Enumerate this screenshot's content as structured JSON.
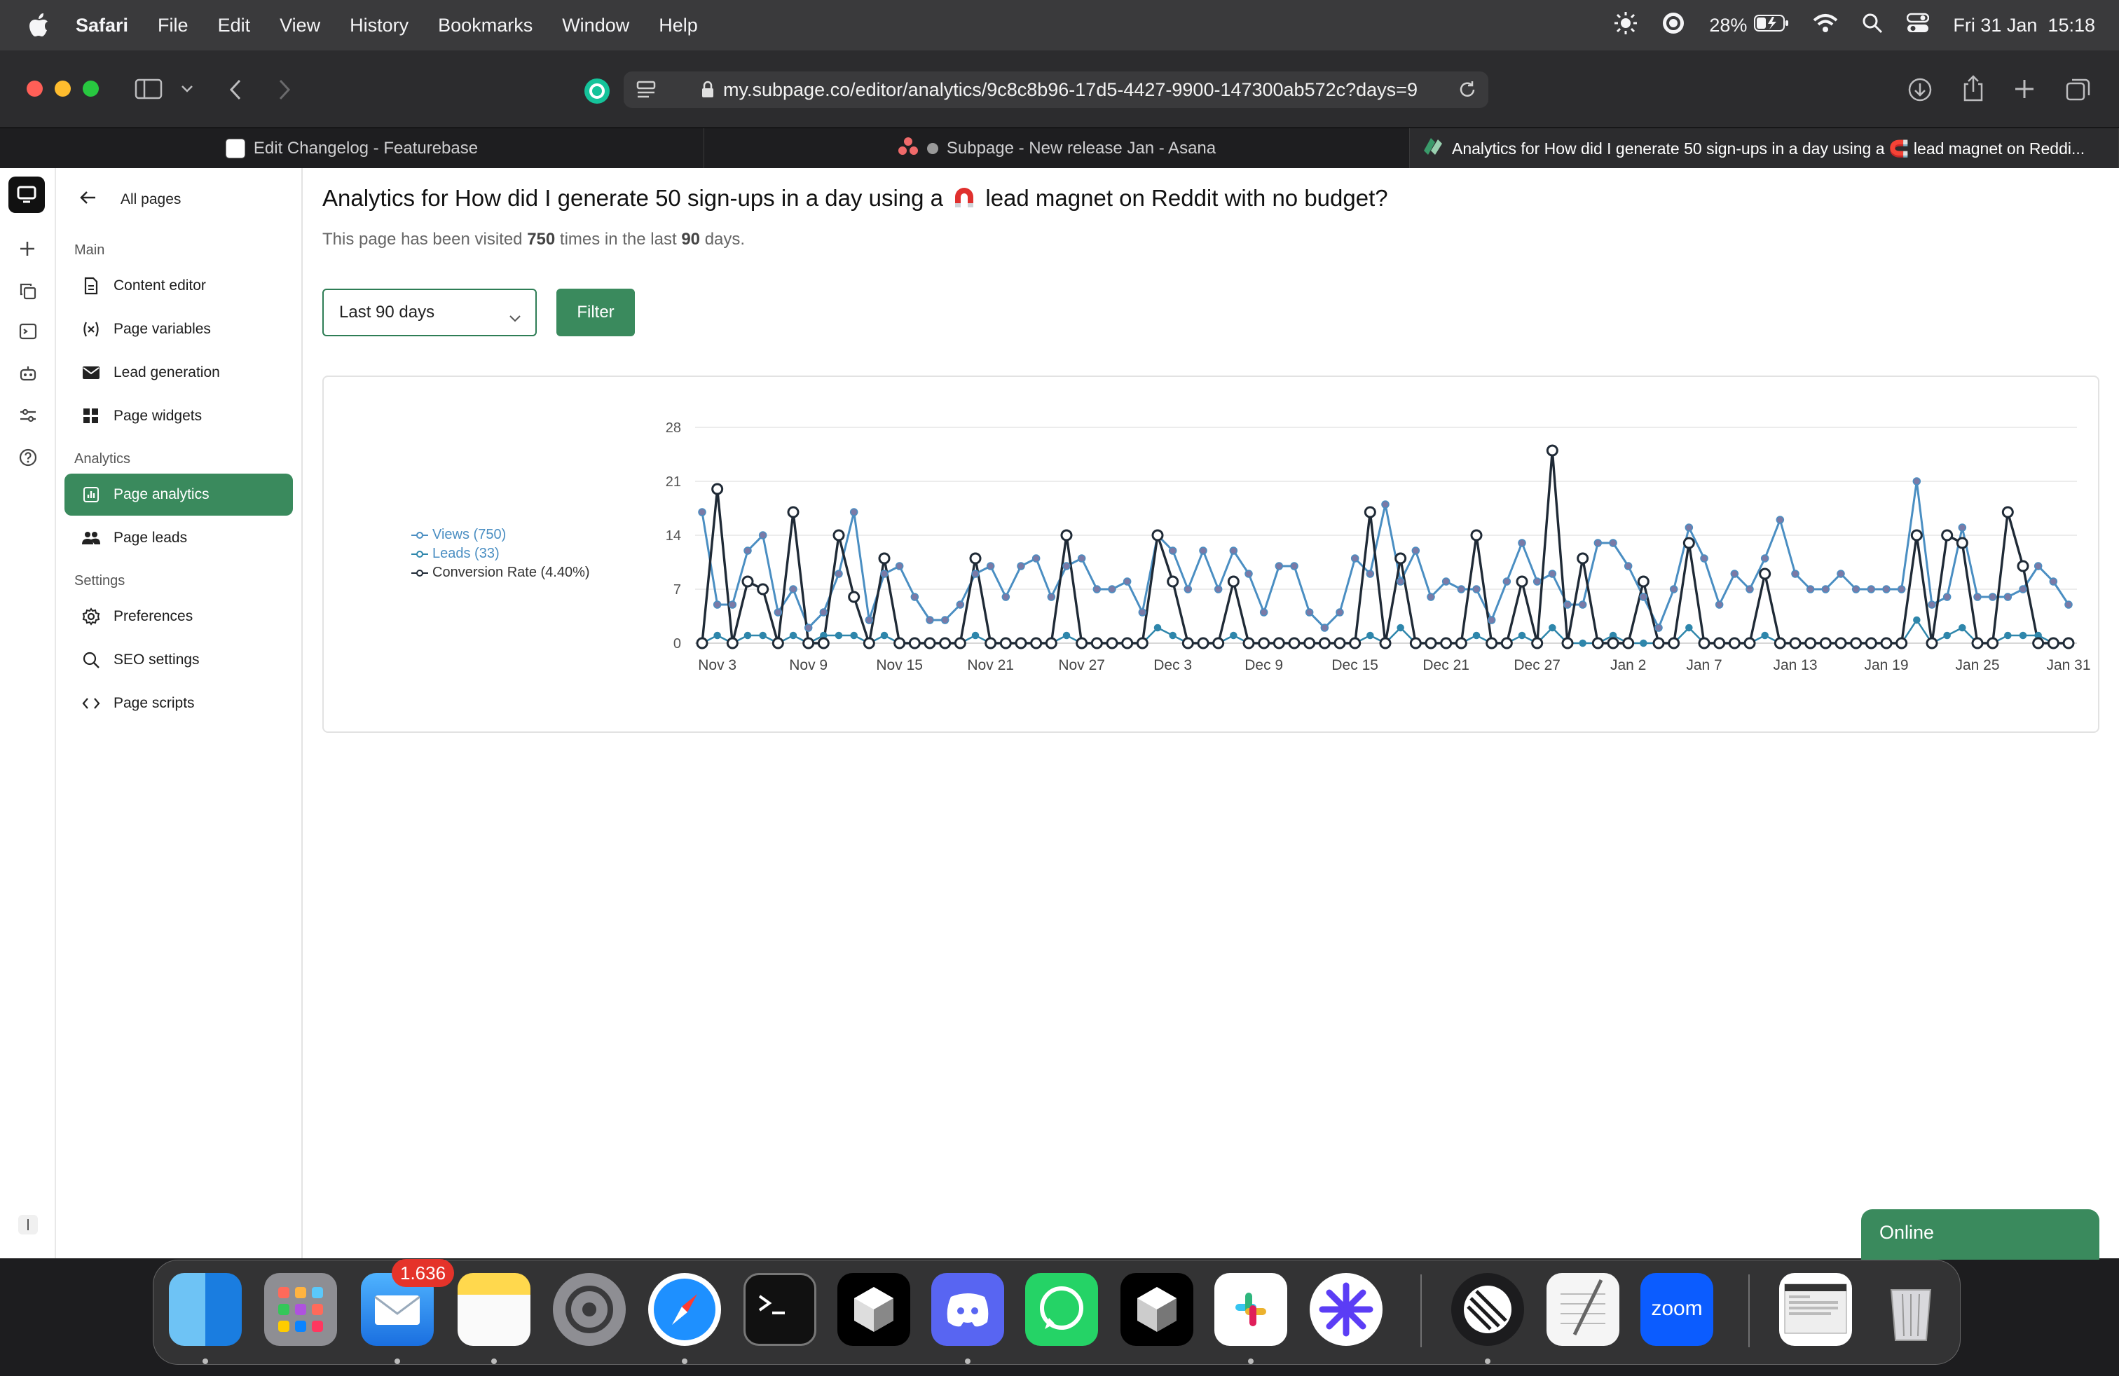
{
  "menubar": {
    "items": [
      "Safari",
      "File",
      "Edit",
      "View",
      "History",
      "Bookmarks",
      "Window",
      "Help"
    ],
    "battery": "28%",
    "datetime": "Fri 31 Jan  15:18"
  },
  "browser": {
    "url": "my.subpage.co/editor/analytics/9c8c8b96-17d5-4427-9900-147300ab572c?days=9",
    "tabs": [
      {
        "label": "Edit Changelog - Featurebase"
      },
      {
        "label": "Subpage - New release Jan - Asana"
      },
      {
        "label": "Analytics for How did I generate 50 sign-ups in a day using a 🧲 lead magnet on Reddi..."
      }
    ]
  },
  "sidebar": {
    "back_label": "All pages",
    "sections": [
      {
        "label": "Main"
      },
      {
        "label": "Analytics"
      },
      {
        "label": "Settings"
      }
    ],
    "items": [
      {
        "label": "Content editor",
        "icon": "document-icon"
      },
      {
        "label": "Page variables",
        "icon": "variable-icon"
      },
      {
        "label": "Lead generation",
        "icon": "mail-icon"
      },
      {
        "label": "Page widgets",
        "icon": "widgets-icon"
      },
      {
        "label": "Page analytics",
        "icon": "chart-icon"
      },
      {
        "label": "Page leads",
        "icon": "people-icon"
      },
      {
        "label": "Preferences",
        "icon": "gear-icon"
      },
      {
        "label": "SEO settings",
        "icon": "search-icon"
      },
      {
        "label": "Page scripts",
        "icon": "code-icon"
      }
    ]
  },
  "main": {
    "title_before": "Analytics for How did I generate 50 sign-ups in a day using a",
    "title_after": "lead magnet on Reddit with no budget?",
    "visits_pre": "This page has been visited",
    "visits": "750",
    "visits_mid": "times in the last",
    "days": "90",
    "visits_post": "days.",
    "range_select": "Last 90 days",
    "filter_label": "Filter",
    "online_label": "Online"
  },
  "dock": {
    "mail_badge": "1.636",
    "zoom_label": "zoom"
  },
  "colors": {
    "accent": "#3a8a5d",
    "views": "#4a8ec2",
    "leads": "#2e86ab",
    "conversion": "#1f2a36"
  },
  "chart_data": {
    "type": "line",
    "x_start": "Nov 2",
    "x_tick_labels": [
      "Nov 3",
      "Nov 9",
      "Nov 15",
      "Nov 21",
      "Nov 27",
      "Dec 3",
      "Dec 9",
      "Dec 15",
      "Dec 21",
      "Dec 27",
      "Jan 2",
      "Jan 7",
      "Jan 13",
      "Jan 19",
      "Jan 25",
      "Jan 31"
    ],
    "y_ticks": [
      0,
      7,
      14,
      21,
      28
    ],
    "ylim": [
      0,
      28
    ],
    "legend_position": "left",
    "grid": true,
    "series": [
      {
        "name": "Views (750)",
        "values": [
          17,
          5,
          5,
          12,
          14,
          4,
          7,
          2,
          4,
          9,
          17,
          3,
          9,
          10,
          6,
          3,
          3,
          5,
          9,
          10,
          6,
          10,
          11,
          6,
          10,
          11,
          7,
          7,
          8,
          4,
          14,
          12,
          7,
          12,
          7,
          12,
          9,
          4,
          10,
          10,
          4,
          2,
          4,
          11,
          9,
          18,
          8,
          12,
          6,
          8,
          7,
          7,
          3,
          8,
          13,
          8,
          9,
          5,
          5,
          13,
          13,
          10,
          6,
          2,
          7,
          15,
          11,
          5,
          9,
          7,
          11,
          16,
          9,
          7,
          7,
          9,
          7,
          7,
          7,
          7,
          21,
          5,
          6,
          15,
          6,
          6,
          6,
          7,
          10,
          8,
          5
        ]
      },
      {
        "name": "Leads (33)",
        "values": [
          0,
          1,
          0,
          1,
          1,
          0,
          1,
          0,
          1,
          1,
          1,
          0,
          1,
          0,
          0,
          0,
          0,
          0,
          1,
          0,
          0,
          0,
          0,
          0,
          1,
          0,
          0,
          0,
          0,
          0,
          2,
          1,
          0,
          0,
          0,
          1,
          0,
          0,
          0,
          0,
          0,
          0,
          0,
          0,
          1,
          0,
          2,
          0,
          0,
          0,
          0,
          1,
          0,
          0,
          1,
          0,
          2,
          0,
          0,
          0,
          1,
          0,
          0,
          0,
          0,
          2,
          0,
          0,
          0,
          0,
          1,
          0,
          0,
          0,
          0,
          0,
          0,
          0,
          0,
          0,
          3,
          0,
          1,
          2,
          0,
          0,
          1,
          1,
          1,
          0,
          0
        ]
      },
      {
        "name": "Conversion Rate (4.40%)",
        "values": [
          0,
          20,
          0,
          8,
          7,
          0,
          17,
          0,
          0,
          14,
          6,
          0,
          11,
          0,
          0,
          0,
          0,
          0,
          11,
          0,
          0,
          0,
          0,
          0,
          14,
          0,
          0,
          0,
          0,
          0,
          14,
          8,
          0,
          0,
          0,
          8,
          0,
          0,
          0,
          0,
          0,
          0,
          0,
          0,
          17,
          0,
          11,
          0,
          0,
          0,
          0,
          14,
          0,
          0,
          8,
          0,
          25,
          0,
          11,
          0,
          0,
          0,
          8,
          0,
          0,
          13,
          0,
          0,
          0,
          0,
          9,
          0,
          0,
          0,
          0,
          0,
          0,
          0,
          0,
          0,
          14,
          0,
          14,
          13,
          0,
          0,
          17,
          10,
          0,
          0,
          0
        ]
      }
    ]
  }
}
